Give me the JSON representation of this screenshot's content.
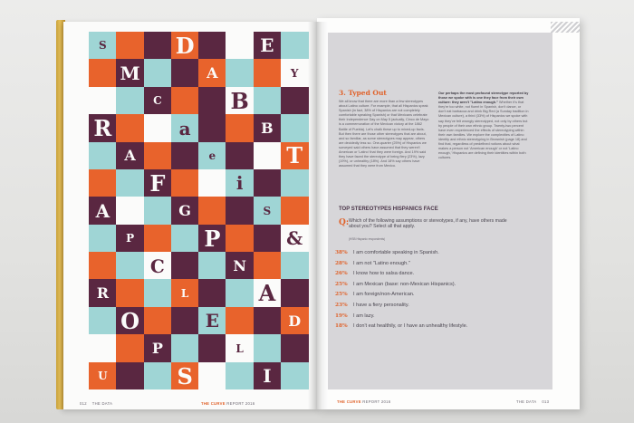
{
  "left_page": {
    "folio": "012",
    "section": "THE DATA",
    "footer_title": "THE CURVE",
    "footer_suffix": "REPORT 2016",
    "mosaic_glyphs": [
      "S",
      "D",
      "E",
      "M",
      "A",
      "Y",
      "C",
      "B",
      "R",
      "a",
      "B",
      "A",
      "e",
      "T",
      "F",
      "i",
      "A",
      "G",
      "S",
      "P",
      "P",
      "&",
      "C",
      "N",
      "R",
      "L",
      "A",
      "O",
      "E",
      "D",
      "P",
      "L",
      "U",
      "S",
      "I",
      "H",
      "S",
      "A",
      "O",
      "&"
    ]
  },
  "right_page": {
    "folio": "013",
    "section": "THE DATA",
    "footer_title": "THE CURVE",
    "footer_suffix": "REPORT 2016",
    "section_title": "3. Typed Out",
    "col_a": "We all know that there are more than a few stereotypes about Latino culture. For example, that all Hispanics speak Spanish (in fact, 38% of Hispanics are not completely comfortable speaking Spanish) or that Mexicans celebrate their Independence Day on May 5 (actually, Cinco de Mayo is a commemoration of the Mexican victory at the 1862 Battle of Puebla). Let's chalk these up to mixed-up facts. But then there are those other stereotypes that are about, and so familiar, as some stereotypes may appear, others are decidedly less so. One-quarter (25%) of Hispanics we surveyed said others have assumed that they weren't American or 'Latino' that they were foreign. And 19% said they have faced the stereotype of being fiery (23%), lazy (19%), or unhealthy (18%). And 18% say others have assumed that they were from Mexico.",
    "col_b_lead": "Our perhaps the most profound stereotype reported by those we spoke with is one they face from their own culture: they aren't \"Latino enough.\"",
    "col_b": "Whether it's that they're too white, not fluent in Spanish, don't dance, or don't eat barbacoa and drink Big Red (a Sunday tradition in Mexican culture), a third (33%) of Hispanics we spoke with say they've felt wrongly stereotyped, not only by others but by people of their own ethnic group. Twenty-two percent have even experienced the effects of stereotyping within their own families. We explore the complexities of Latino identity and ethnic stereotyping in Brownish (page 18) and find that, regardless of predefined notions about what makes a person not 'American enough' or not 'Latino enough,' Hispanics are defining their identities within both cultures.",
    "chart_heading": "TOP STEREOTYPES HISPANICS FACE",
    "question_mark": "Q:",
    "question": "Which of the following assumptions or stereotypes, if any, have others made about you? Select all that apply.",
    "question_note": "(HSB Hispanic respondents)"
  },
  "chart_data": {
    "type": "table",
    "title": "TOP STEREOTYPES HISPANICS FACE",
    "rows": [
      {
        "value": 38,
        "label": "I am comfortable speaking in Spanish."
      },
      {
        "value": 28,
        "label": "I am not \"Latino enough.\""
      },
      {
        "value": 26,
        "label": "I know how to salsa dance."
      },
      {
        "value": 25,
        "label": "I am Mexican (base: non-Mexican Hispanics)."
      },
      {
        "value": 25,
        "label": "I am foreign/non-American."
      },
      {
        "value": 23,
        "label": "I have a fiery personality."
      },
      {
        "value": 19,
        "label": "I am lazy."
      },
      {
        "value": 18,
        "label": "I don't eat healthily, or I have an unhealthy lifestyle."
      }
    ],
    "value_suffix": "%"
  },
  "colors": {
    "orange": "#e8632c",
    "teal": "#9fd5d5",
    "plum": "#5a2741",
    "cream": "#fbfbfa",
    "panel": "#d7d6d9"
  }
}
